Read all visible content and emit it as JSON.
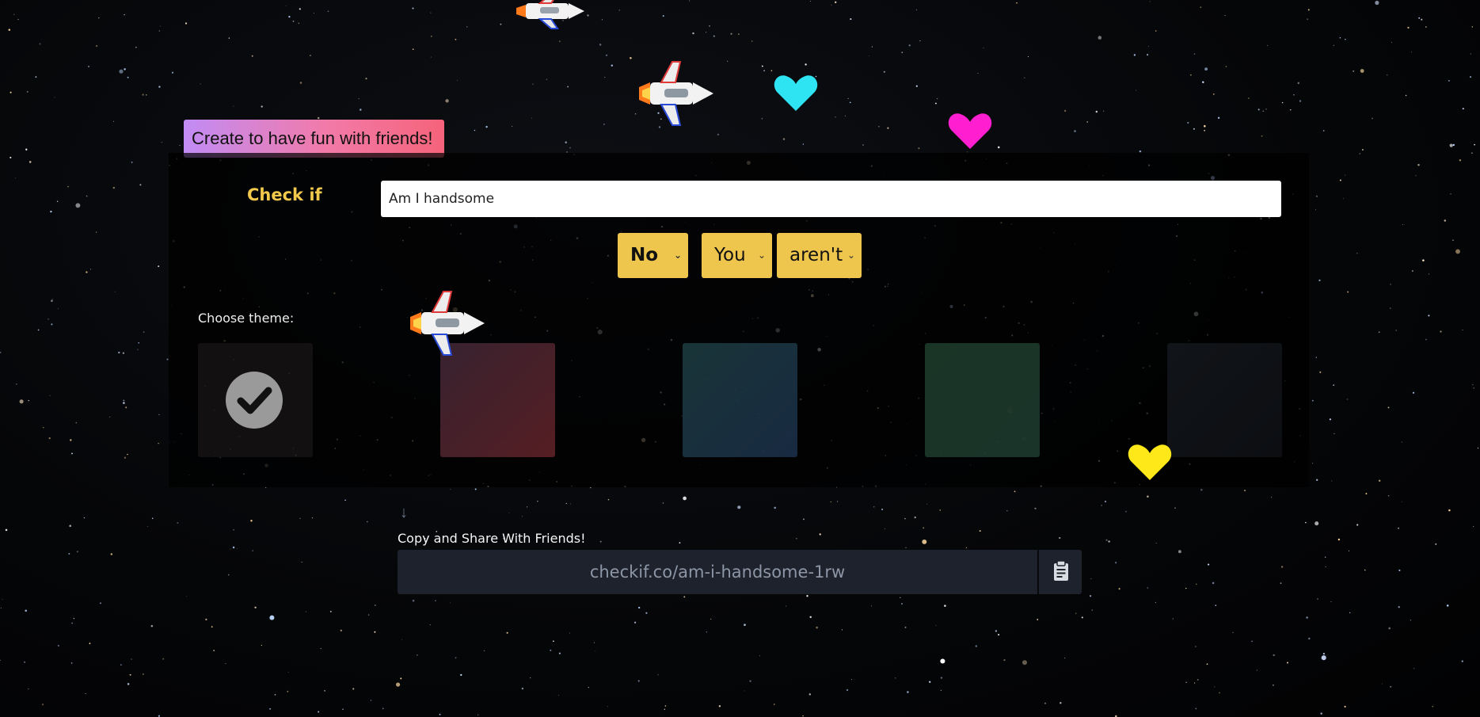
{
  "header": {
    "badge_text": "Create to have fun with friends!"
  },
  "form": {
    "check_label": "Check if",
    "question_value": "Am I handsome",
    "answer_selects": [
      {
        "selected": "No"
      },
      {
        "selected": "You"
      },
      {
        "selected": "aren't"
      }
    ]
  },
  "theme": {
    "label": "Choose theme:",
    "selected_index": 0,
    "options_count": 5
  },
  "share": {
    "label": "Copy and Share With Friends!",
    "link": "checkif.co/am-i-handsome-1rw",
    "copy_icon": "clipboard-icon"
  },
  "decorations": {
    "icons": [
      "spaceship-icon",
      "heart-icon"
    ],
    "heart_colors": [
      "#2ee3f2",
      "#ff1fd0",
      "#ffe81a"
    ]
  }
}
